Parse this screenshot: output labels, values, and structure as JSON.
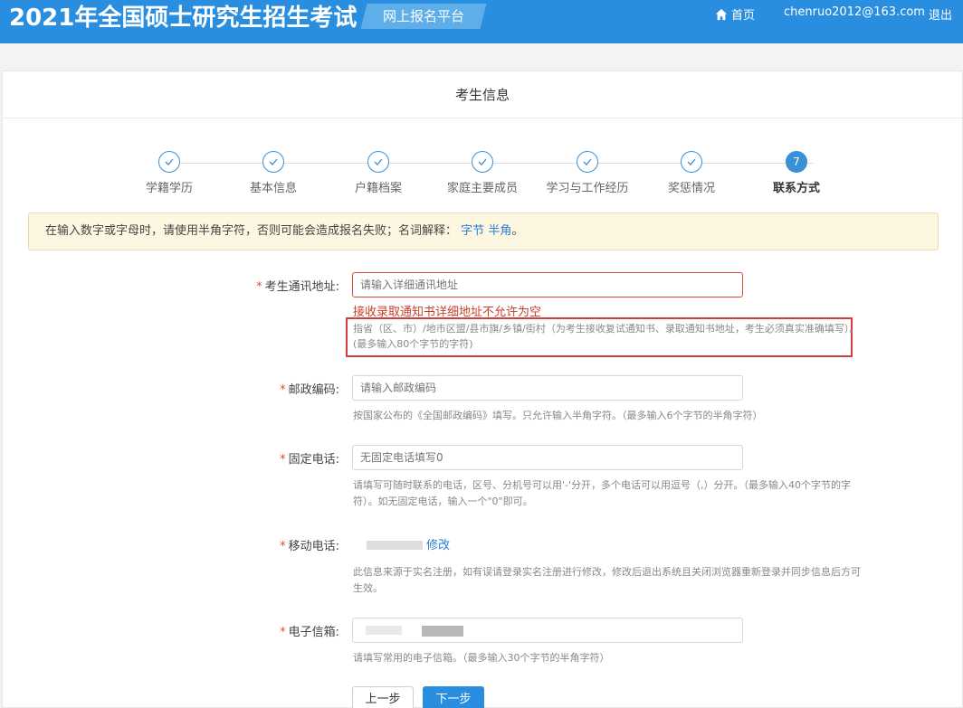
{
  "header": {
    "title": "2021年全国硕士研究生招生考试",
    "platform": "网上报名平台",
    "home": "首页",
    "email": "chenruo2012@163.com",
    "logout": "退出",
    "color": "#2a8ee0"
  },
  "panel": {
    "title": "考生信息"
  },
  "steps": [
    {
      "label": "学籍学历",
      "state": "done"
    },
    {
      "label": "基本信息",
      "state": "done"
    },
    {
      "label": "户籍档案",
      "state": "done"
    },
    {
      "label": "家庭主要成员",
      "state": "done"
    },
    {
      "label": "学习与工作经历",
      "state": "done"
    },
    {
      "label": "奖惩情况",
      "state": "done"
    },
    {
      "label": "联系方式",
      "state": "current",
      "number": "7"
    }
  ],
  "notice": {
    "text": "在输入数字或字母时，请使用半角字符，否则可能会造成报名失败；名词解释：",
    "link1": "字节",
    "link2": "半角",
    "end": "。"
  },
  "form": {
    "address": {
      "label": "考生通讯地址:",
      "placeholder": "请输入详细通讯地址",
      "error": "接收录取通知书详细地址不允许为空",
      "hint1": "指省（区、市）/地市区盟/县市旗/乡镇/街村（为考生接收复试通知书、录取通知书地址，考生必须真实准确填写）。",
      "hint2": "(最多输入80个字节的字符)"
    },
    "postcode": {
      "label": "邮政编码:",
      "placeholder": "请输入邮政编码",
      "hint": "按国家公布的《全国邮政编码》填写。只允许输入半角字符。（最多输入6个字节的半角字符）"
    },
    "phone": {
      "label": "固定电话:",
      "placeholder": "无固定电话填写0",
      "hint1": "请填写可随时联系的电话，区号、分机号可以用'-'分开，多个电话可以用逗号（,）分开。（最多输入40个字节的字",
      "hint2": "符）。如无固定电话，输入一个\"0\"即可。"
    },
    "mobile": {
      "label": "移动电话:",
      "link": "修改",
      "hint1": "此信息来源于实名注册，如有误请登录实名注册进行修改，修改后退出系统且关闭浏览器重新登录并同步信息后方可",
      "hint2": "生效。"
    },
    "mail": {
      "label": "电子信箱:",
      "hint": "请填写常用的电子信箱。（最多输入30个字节的半角字符）"
    }
  },
  "buttons": {
    "prev": "上一步",
    "next": "下一步"
  }
}
